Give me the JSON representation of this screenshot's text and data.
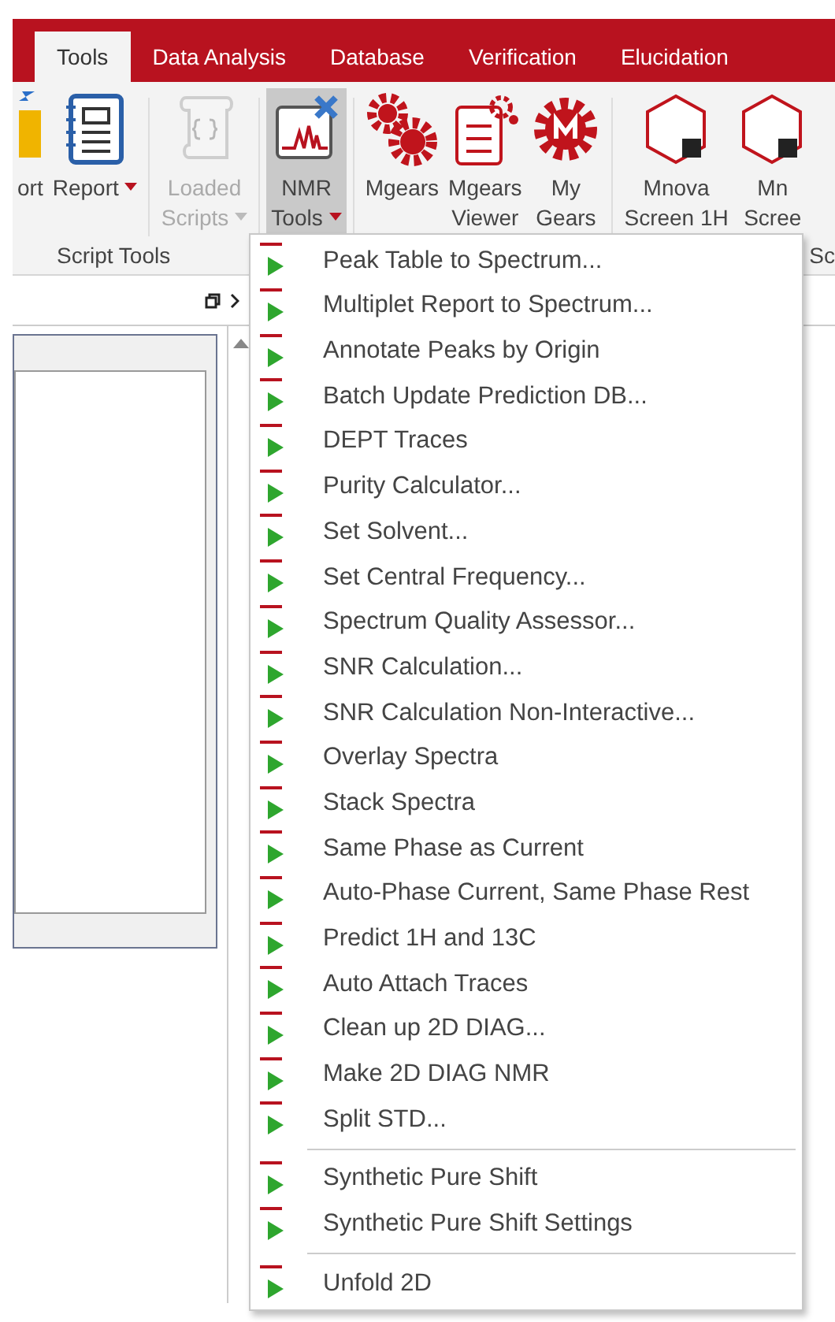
{
  "tabs": [
    {
      "label": "Tools",
      "selected": true
    },
    {
      "label": "Data Analysis",
      "selected": false
    },
    {
      "label": "Database",
      "selected": false
    },
    {
      "label": "Verification",
      "selected": false
    },
    {
      "label": "Elucidation",
      "selected": false
    }
  ],
  "ribbon": {
    "buttons": [
      {
        "kind": "cut",
        "lines": [
          "ort"
        ],
        "dropdown": false,
        "disabled": false,
        "pressed": false
      },
      {
        "kind": "report",
        "lines": [
          "Report"
        ],
        "dropdown": true,
        "disabled": false,
        "pressed": false
      },
      {
        "kind": "scripts",
        "lines": [
          "Loaded",
          "Scripts"
        ],
        "dropdown": true,
        "disabled": true,
        "pressed": false
      },
      {
        "kind": "nmr",
        "lines": [
          "NMR",
          "Tools"
        ],
        "dropdown": true,
        "disabled": false,
        "pressed": true
      },
      {
        "kind": "gears",
        "lines": [
          "Mgears"
        ],
        "dropdown": false,
        "disabled": false,
        "pressed": false
      },
      {
        "kind": "viewer",
        "lines": [
          "Mgears",
          "Viewer"
        ],
        "dropdown": false,
        "disabled": false,
        "pressed": false
      },
      {
        "kind": "mygear",
        "lines": [
          "My",
          "Gears"
        ],
        "dropdown": false,
        "disabled": false,
        "pressed": false
      },
      {
        "kind": "screen",
        "lines": [
          "Mnova",
          "Screen 1H"
        ],
        "dropdown": false,
        "disabled": false,
        "pressed": false
      },
      {
        "kind": "screen",
        "lines": [
          "Mn",
          "Scree"
        ],
        "dropdown": false,
        "disabled": false,
        "pressed": false
      }
    ],
    "group_labels": [
      "Script Tools",
      "Sc"
    ]
  },
  "menu": {
    "groups": [
      [
        "Peak Table to Spectrum...",
        "Multiplet Report to Spectrum...",
        "Annotate Peaks by Origin",
        "Batch Update Prediction DB...",
        "DEPT Traces",
        "Purity Calculator...",
        "Set Solvent...",
        "Set Central Frequency...",
        "Spectrum Quality Assessor...",
        "SNR Calculation...",
        "SNR Calculation Non-Interactive...",
        "Overlay Spectra",
        "Stack Spectra",
        "Same Phase as Current",
        "Auto-Phase Current, Same Phase Rest",
        "Predict 1H and 13C",
        "Auto Attach Traces",
        "Clean up 2D DIAG...",
        "Make 2D DIAG NMR",
        "Split STD..."
      ],
      [
        "Synthetic Pure Shift",
        "Synthetic Pure Shift Settings"
      ],
      [
        "Unfold 2D"
      ]
    ]
  }
}
